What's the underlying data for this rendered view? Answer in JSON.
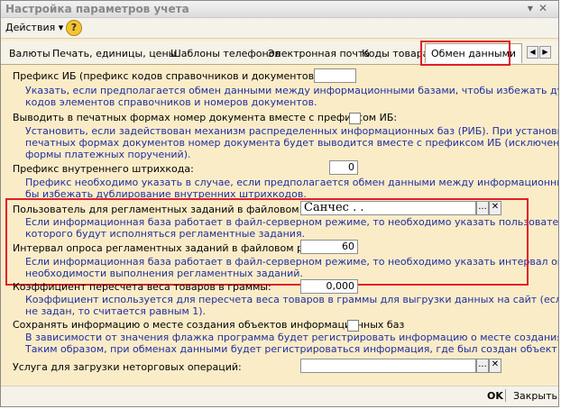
{
  "window": {
    "title": "Настройка параметров учета",
    "minimize_label": "▾",
    "close_label": "✕"
  },
  "toolbar": {
    "actions_label": "Действия ▾",
    "help_label": "?"
  },
  "tabs": [
    "Валюты",
    "Печать, единицы, цены",
    "Шаблоны телефонов",
    "Электронная почта",
    "Коды товара",
    "Обмен данными"
  ],
  "tab_nav": {
    "prev": "◀",
    "next": "▶"
  },
  "settings": {
    "prefix_ib": {
      "label": "Префикс ИБ (префикс кодов справочников и документов):",
      "value": "",
      "hint": [
        "Указать, если предполагается обмен данными между информационными базами, чтобы избежать дублирования",
        "кодов элементов справочников и номеров документов."
      ]
    },
    "print_prefix": {
      "label": "Выводить в печатных формах номер документа вместе с префиксом ИБ:",
      "hint": [
        "Установить, если задействован механизм распределенных информационных баз (РИБ). При установке флага в",
        "печатных формах документов  номер документа будет выводится вместе с префиксом ИБ (исключение - печатные",
        "формы платежных поручений)."
      ]
    },
    "barcode_prefix": {
      "label": "Префикс внутреннего штрихкода:",
      "value": "0",
      "hint": [
        "Префикс необходимо указать в случае, если предполагается обмен данными между информационными базами, что",
        "бы избежать дублирование внутренних штрихкодов."
      ]
    },
    "reg_user": {
      "label": "Пользователь для регламентных заданий в файловом режиме:",
      "value": "Санчес . .",
      "select_btn": "...",
      "clear_btn": "✕",
      "hint": [
        "Если информационная база работает в файл-серверном режиме, то необходимо указать пользователя при работе",
        "которого будут исполняться регламентные задания."
      ]
    },
    "poll_interval": {
      "label": "Интервал опроса регламентных заданий в файловом режиме:",
      "value": "60",
      "hint": [
        "Если информационная база работает в файл-серверном режиме, то необходимо указать интервал опроса",
        "необходимости выполнения регламентных заданий."
      ]
    },
    "weight_coef": {
      "label": "Коэффициент пересчета веса товаров в граммы:",
      "value": "0,000",
      "hint": [
        "Коэффициент используется для пересчета веса товаров в граммы для выгрузки данных на сайт (если коэффициент",
        "не задан, то считается равным 1)."
      ]
    },
    "save_place": {
      "label": "Сохранять информацию о месте создания объектов информационных баз",
      "hint": [
        "В зависимости от значения флажка программа будет регистрировать информацию о месте создания объектов.",
        "Таким образом, при обменах данными будет регистрироваться информация, где был создан объект."
      ]
    },
    "service": {
      "label": "Услуга для загрузки неторговых операций:",
      "value": "",
      "select_btn": "...",
      "clear_btn": "✕"
    }
  },
  "footer": {
    "ok_label": "OK",
    "close_label": "Закрыть"
  }
}
